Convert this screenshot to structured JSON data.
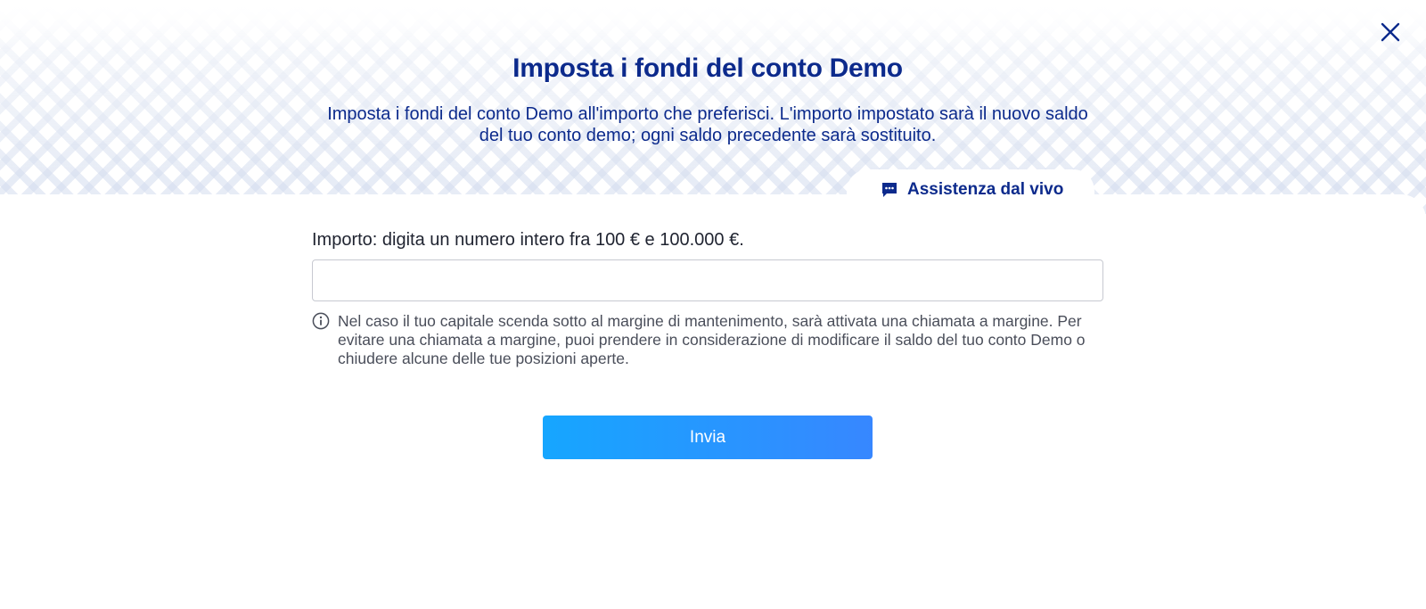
{
  "header": {
    "title": "Imposta i fondi del conto Demo",
    "subtitle": "Imposta i fondi del conto Demo all'importo che preferisci. L'importo impostato sarà il nuovo saldo del tuo conto demo; ogni saldo precedente sarà sostituito."
  },
  "support": {
    "label": "Assistenza dal vivo",
    "icon": "chat-icon"
  },
  "form": {
    "amount_label": "Importo: digita un numero intero fra 100 € e 100.000 €.",
    "amount_value": "",
    "amount_placeholder": "",
    "info_text": "Nel caso il tuo capitale scenda sotto al margine di mantenimento, sarà attivata una chiamata a margine. Per evitare una chiamata a margine, puoi prendere in considerazione di modificare il saldo del tuo conto Demo o chiudere alcune delle tue posizioni aperte.",
    "submit_label": "Invia"
  },
  "icons": {
    "close": "close-icon",
    "info": "info-icon"
  },
  "colors": {
    "brand_navy": "#0c2a8c",
    "button_gradient_start": "#16a6ff",
    "button_gradient_end": "#3787ff"
  }
}
